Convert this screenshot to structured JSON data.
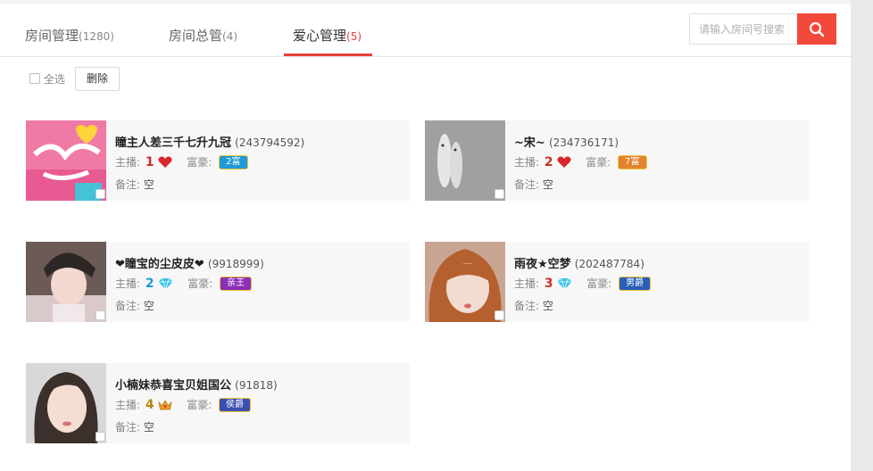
{
  "tabs": [
    {
      "label": "房间管理",
      "count": "(1280)"
    },
    {
      "label": "房间总管",
      "count": "(4)"
    },
    {
      "label": "爱心管理",
      "count": "(5)"
    }
  ],
  "search": {
    "placeholder": "请输入房间号搜索"
  },
  "toolbar": {
    "select_all": "全选",
    "delete": "删除"
  },
  "labels": {
    "anchor": "主播:",
    "rich": "富豪:",
    "remark": "备注:"
  },
  "cards": [
    {
      "name": "瞳主人差三千七升九冠",
      "id": "(243794592)",
      "anchor_level": "1",
      "anchor_icon": "heart-icon",
      "rich_badge": "2富",
      "remark": "空"
    },
    {
      "name": "~宋~",
      "id": "(234736171)",
      "anchor_level": "2",
      "anchor_icon": "heart-icon",
      "rich_badge": "7富",
      "remark": "空"
    },
    {
      "name": "❤瞳宝的尘皮皮❤",
      "id": "(9918999)",
      "anchor_level": "2",
      "anchor_icon": "diamond-icon",
      "rich_badge": "亲王",
      "remark": "空"
    },
    {
      "name": "雨夜★空梦",
      "id": "(202487784)",
      "anchor_level": "3",
      "anchor_icon": "diamond-icon",
      "rich_badge": "男爵",
      "remark": "空"
    },
    {
      "name": "小楠妹恭喜宝贝姐国公",
      "id": "(91818)",
      "anchor_level": "4",
      "anchor_icon": "crown-icon",
      "rich_badge": "侯爵",
      "remark": "空"
    }
  ],
  "colors": {
    "accent": "#e8413a",
    "card_bg": "#f7f7f7"
  }
}
